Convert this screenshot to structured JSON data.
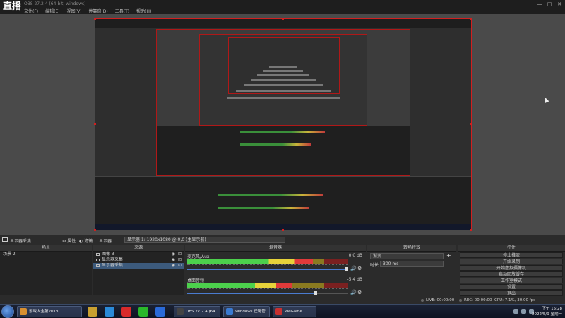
{
  "app": {
    "logo": "直播",
    "title": "OBS 27.2.4 (64-bit, windows)",
    "menus": [
      "文件(F)",
      "编辑(E)",
      "视图(V)",
      "停靠窗(D)",
      "工具(T)",
      "帮助(H)"
    ],
    "window_controls": [
      "—",
      "□",
      "✕"
    ]
  },
  "scene_header": {
    "display_label": "显示器采集",
    "properties_label": "属性",
    "filters_label": "滤镜",
    "source_label": "显示器",
    "screen_value": "显示器 1: 1920x1080 @ 0,0 (主显示器)"
  },
  "docks": {
    "scenes": {
      "title": "场景",
      "items": [
        "场景 2"
      ]
    },
    "sources": {
      "title": "来源",
      "items": [
        {
          "label": "图像 3",
          "selected": false
        },
        {
          "label": "显示器采集",
          "selected": false
        },
        {
          "label": "显示器采集",
          "selected": true
        }
      ]
    },
    "mixer": {
      "title": "混音器",
      "channels": [
        {
          "name": "麦克风/Aux",
          "db": "0.0 dB",
          "level": 0.78,
          "volume": 0.99
        },
        {
          "name": "桌面音频",
          "db": "-5.4 dB",
          "level": 0.65,
          "volume": 0.8
        }
      ]
    },
    "transitions": {
      "title": "转场特效",
      "type_value": "渐变",
      "duration_label": "时长",
      "duration_value": "300 ms"
    },
    "controls": {
      "title": "控件",
      "buttons": [
        "停止推流",
        "开始录制",
        "开始虚拟摄像机",
        "启动回放缓存",
        "工作室模式",
        "设置",
        "退出"
      ]
    },
    "toolbar": {
      "add": "+",
      "remove": "−",
      "config": "⚙",
      "up": "∧",
      "down": "∨"
    }
  },
  "status": {
    "live": "LIVE: 00:00:00",
    "rec": "REC: 00:00:00",
    "cpu": "CPU: 7.1%, 30.00 fps"
  },
  "taskbar": {
    "tasks": [
      {
        "label": "游戏大全第2013...",
        "color": "#d89030"
      },
      {
        "label": "OBS 27.2.4 (64...",
        "color": "#444444"
      },
      {
        "label": "Windows 任务管...",
        "color": "#3a7ad0"
      },
      {
        "label": "WeGame",
        "color": "#c83030"
      }
    ],
    "pinned_colors": [
      "#c8a030",
      "#2a8ad8",
      "#d82a2a",
      "#2ab82a",
      "#2a6ad8"
    ],
    "time": "下午 15:28",
    "date": "2022/5/9 星期一"
  }
}
